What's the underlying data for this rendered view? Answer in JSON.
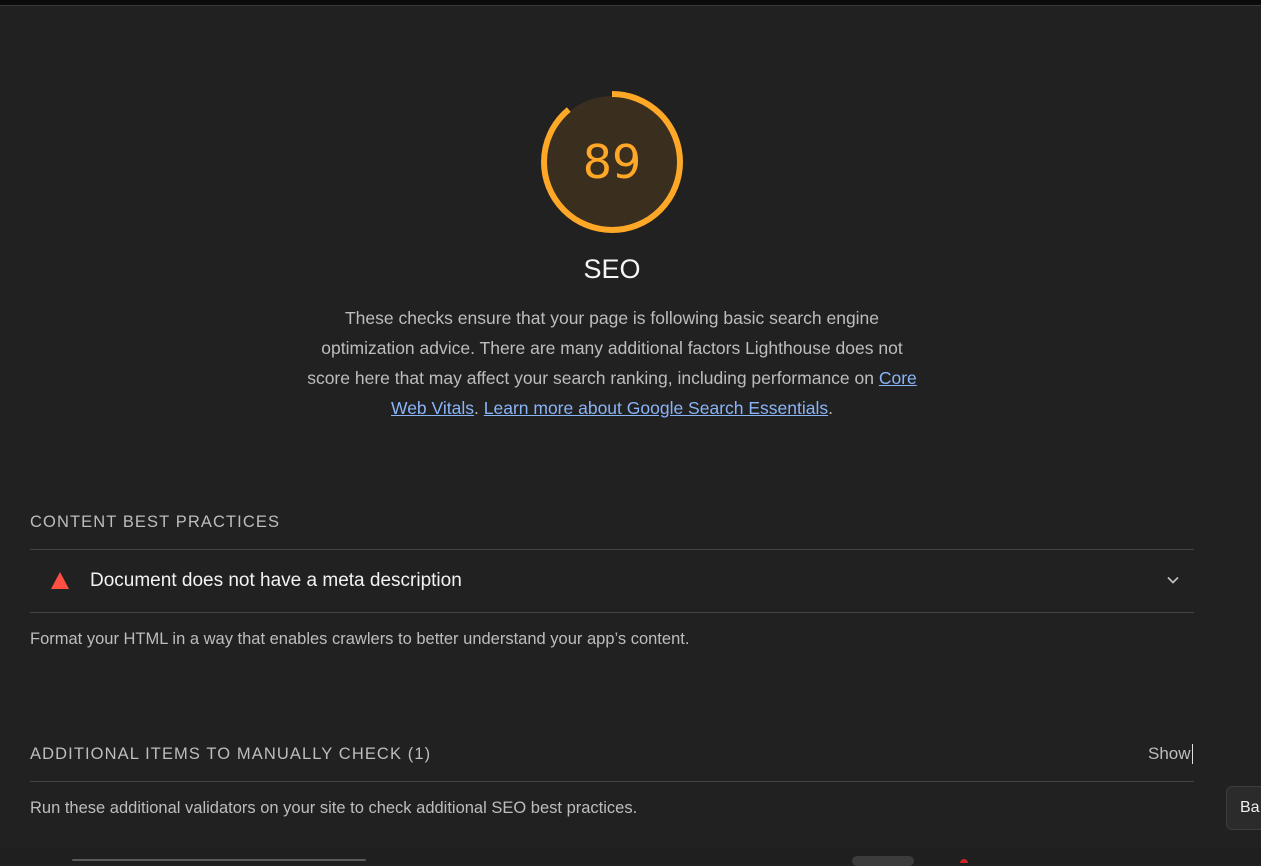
{
  "category": {
    "score": "89",
    "score_fraction": 0.89,
    "score_color": "#ffa726",
    "title": "SEO",
    "description_text": "These checks ensure that your page is following basic search engine optimization advice. There are many additional factors Lighthouse does not score here that may affect your search ranking, including performance on ",
    "link_core_web_vitals": "Core Web Vitals",
    "separator": ". ",
    "link_learn_more": "Learn more about Google Search Essentials",
    "description_end": "."
  },
  "groups": {
    "content": {
      "title": "CONTENT BEST PRACTICES",
      "audit": {
        "title": "Document does not have a meta description",
        "status_icon": "fail-triangle-icon",
        "status_color": "#ff4e42"
      },
      "description": "Format your HTML in a way that enables crawlers to better understand your app’s content."
    },
    "manual": {
      "title": "ADDITIONAL ITEMS TO MANUALLY CHECK (1)",
      "toggle_label": "Show",
      "description": "Run these additional validators on your site to check additional SEO best practices."
    }
  },
  "tooltip": {
    "text": "Ba"
  }
}
